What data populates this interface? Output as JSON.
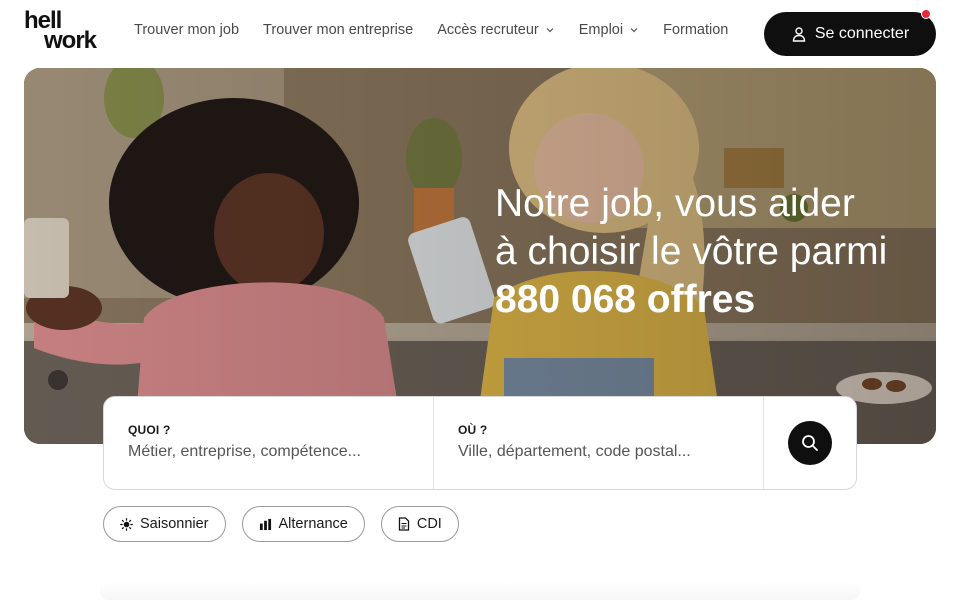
{
  "brand": {
    "logo_line1": "hell",
    "logo_line2": "work"
  },
  "nav": {
    "items": [
      {
        "label": "Trouver mon job",
        "has_dropdown": false
      },
      {
        "label": "Trouver mon entreprise",
        "has_dropdown": false
      },
      {
        "label": "Accès recruteur",
        "has_dropdown": true
      },
      {
        "label": "Emploi",
        "has_dropdown": true
      },
      {
        "label": "Formation",
        "has_dropdown": false
      }
    ],
    "login_label": "Se connecter"
  },
  "hero": {
    "headline_line1": "Notre job, vous aider",
    "headline_line2": "à choisir le vôtre parmi",
    "offers_count": "880 068 offres"
  },
  "search": {
    "what_label": "QUOI ?",
    "what_placeholder": "Métier, entreprise, compétence...",
    "where_label": "OÙ ?",
    "where_placeholder": "Ville, département, code postal..."
  },
  "chips": [
    {
      "label": "Saisonnier",
      "icon": "sun-icon"
    },
    {
      "label": "Alternance",
      "icon": "chart-bars-icon"
    },
    {
      "label": "CDI",
      "icon": "document-icon"
    }
  ],
  "colors": {
    "primary_dark": "#0f0f10",
    "notification": "#e5283a",
    "nav_text": "#4a4a4a"
  }
}
